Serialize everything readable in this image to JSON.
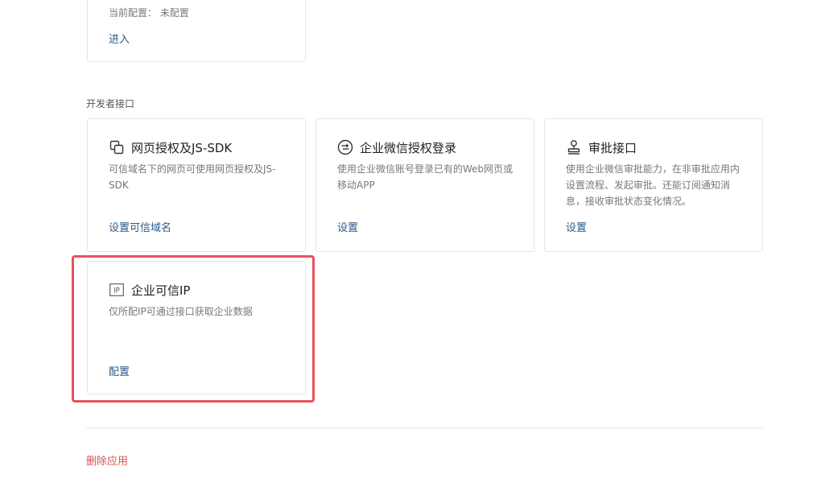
{
  "top_card": {
    "config_text": "当前配置： 未配置",
    "action": "进入"
  },
  "section": {
    "label": "开发者接口"
  },
  "cards": [
    {
      "title": "网页授权及JS-SDK",
      "desc_line1": "可信域名下的网页可使用网页授权及JS-",
      "desc_line2": "SDK",
      "action": "设置可信域名",
      "icon": "web-auth-icon"
    },
    {
      "title": "企业微信授权登录",
      "desc_line1": "使用企业微信账号登录已有的Web网页或",
      "desc_line2": "移动APP",
      "action": "设置",
      "icon": "wechat-login-icon"
    },
    {
      "title": "审批接口",
      "desc_line1": "使用企业微信审批能力，在非审批应用内",
      "desc_line2": "设置流程、发起审批。还能订阅通知消",
      "desc_line3": "息，接收审批状态变化情况。",
      "action": "设置",
      "icon": "stamp-icon"
    },
    {
      "title": "企业可信IP",
      "desc_line1": "仅所配IP可通过接口获取企业数据",
      "action": "配置",
      "icon": "ip-icon",
      "icon_text": "IP"
    }
  ],
  "footer": {
    "delete_label": "删除应用"
  },
  "colors": {
    "link": "#2b5b8a",
    "danger": "#d9534f",
    "highlight": "#e9515f"
  }
}
